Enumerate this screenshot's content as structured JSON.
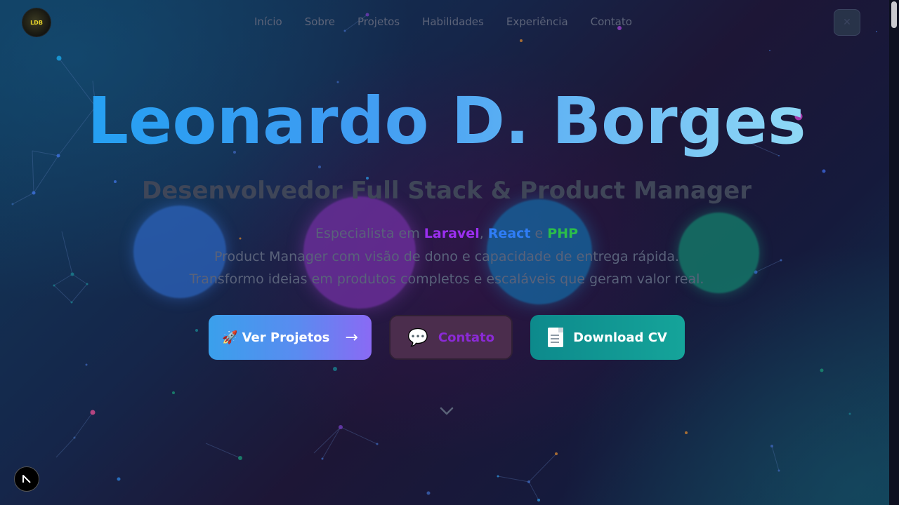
{
  "brand": {
    "logo_text": "LDB"
  },
  "nav": {
    "items": [
      "Início",
      "Sobre",
      "Projetos",
      "Habilidades",
      "Experiência",
      "Contato"
    ]
  },
  "hero": {
    "name": "Leonardo D. Borges",
    "subtitle": "Desenvolvedor Full Stack & Product Manager",
    "specialist_prefix": "Especialista em",
    "tech1": "Laravel",
    "comma": ",",
    "tech2": "React",
    "and": "e",
    "tech3": "PHP",
    "line2": "Product Manager com visão de dono e capacidade de entrega rápida.",
    "line3": "Transformo ideias em produtos completos e escaláveis que geram valor real."
  },
  "buttons": {
    "projects": {
      "emoji": "🚀",
      "label": "Ver Projetos",
      "arrow": "→"
    },
    "contact": {
      "emoji": "💬",
      "label": "Contato"
    },
    "cv": {
      "label": "Download CV"
    }
  },
  "colors": {
    "title_gradient_start": "#1da1f2",
    "title_gradient_end": "#9fe7f7",
    "laravel": "#9b2ff0",
    "react": "#2f7df6",
    "php": "#2bbd4a"
  },
  "icons": {
    "scroll": "chevron-down-icon",
    "corner": "arrow-up-left-icon",
    "menu": "close-icon"
  }
}
